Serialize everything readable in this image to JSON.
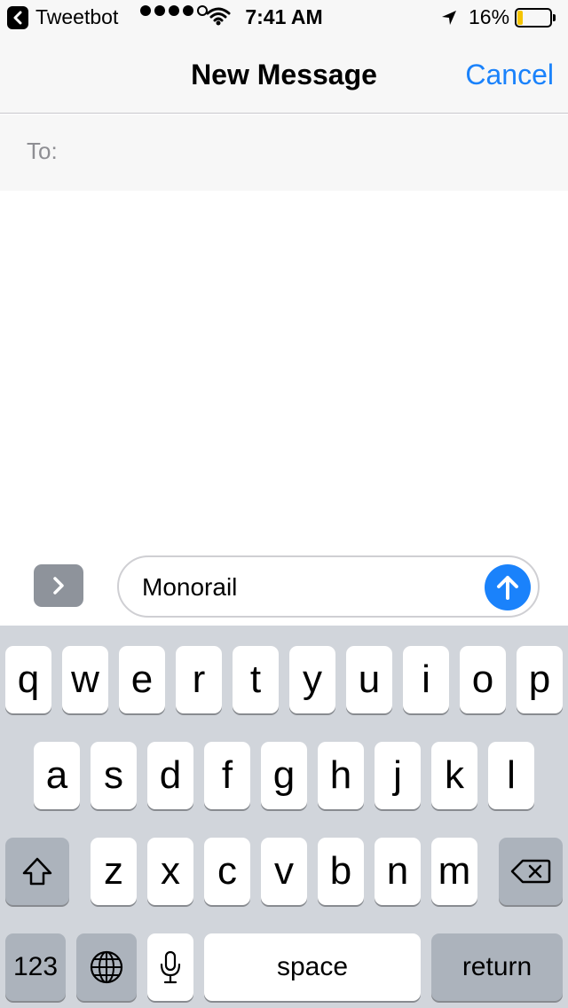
{
  "status_bar": {
    "back_app": "Tweetbot",
    "time": "7:41 AM",
    "battery_percent": "16%",
    "battery_level": 0.16,
    "signal_bars_filled": 4,
    "signal_bars_total": 5
  },
  "nav": {
    "title": "New Message",
    "cancel_label": "Cancel"
  },
  "to_field": {
    "label": "To:",
    "value": ""
  },
  "compose": {
    "text": "Monorail"
  },
  "keyboard": {
    "row1": [
      "q",
      "w",
      "e",
      "r",
      "t",
      "y",
      "u",
      "i",
      "o",
      "p"
    ],
    "row2": [
      "a",
      "s",
      "d",
      "f",
      "g",
      "h",
      "j",
      "k",
      "l"
    ],
    "row3": [
      "z",
      "x",
      "c",
      "v",
      "b",
      "n",
      "m"
    ],
    "numbers_label": "123",
    "space_label": "space",
    "return_label": "return"
  },
  "colors": {
    "accent": "#1a82fb",
    "battery_fill": "#f5c400",
    "keyboard_bg": "#d1d5db"
  }
}
